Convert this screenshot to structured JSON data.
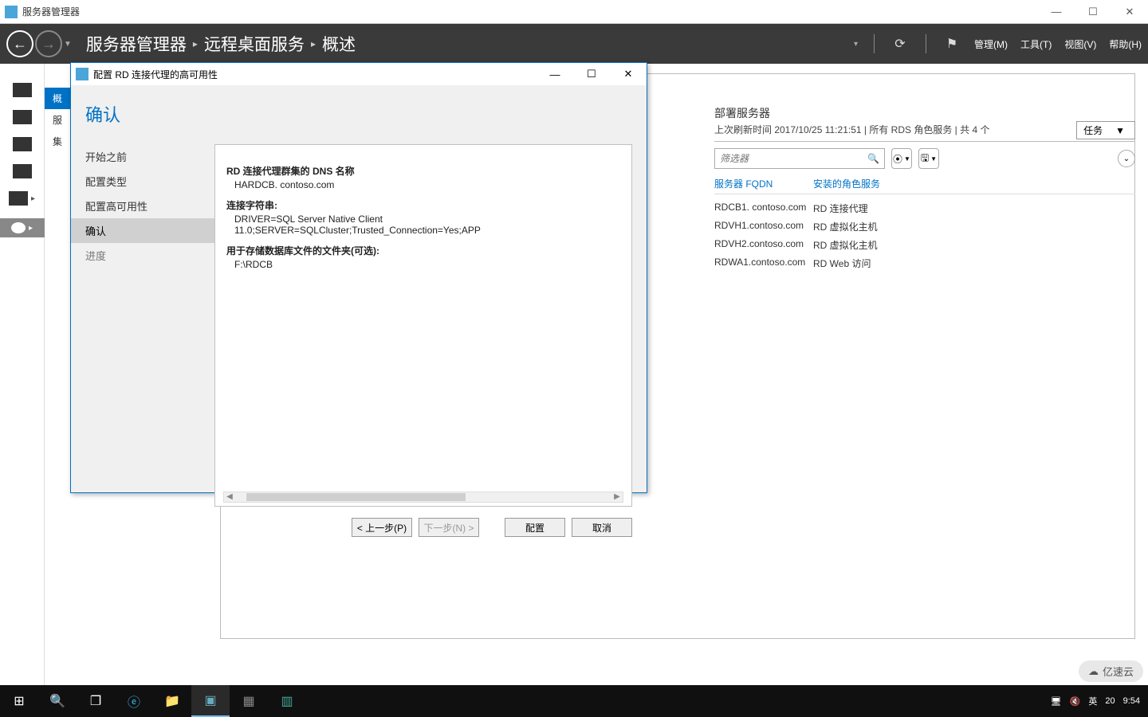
{
  "window": {
    "title": "服务器管理器",
    "minimize": "—",
    "maximize": "☐",
    "close": "✕"
  },
  "breadcrumb": {
    "part1": "服务器管理器",
    "part2": "远程桌面服务",
    "part3": "概述",
    "sep": "▸"
  },
  "menu": {
    "manage": "管理(M)",
    "tools": "工具(T)",
    "view": "视图(V)",
    "help": "帮助(H)"
  },
  "sidetabs": {
    "t1": "概",
    "t2": "服",
    "t3": "集"
  },
  "deploy": {
    "title": "部署服务器",
    "subtitle": "上次刷新时间 2017/10/25 11:21:51 | 所有 RDS 角色服务 | 共 4 个",
    "tasks": "任务",
    "filter_placeholder": "筛选器",
    "col_fqdn": "服务器 FQDN",
    "col_role": "安装的角色服务",
    "rows": [
      {
        "fqdn": "RDCB1. contoso.com",
        "role": "RD 连接代理"
      },
      {
        "fqdn": "RDVH1.contoso.com",
        "role": "RD 虚拟化主机"
      },
      {
        "fqdn": "RDVH2.contoso.com",
        "role": "RD 虚拟化主机"
      },
      {
        "fqdn": "RDWA1.contoso.com",
        "role": "RD Web 访问"
      }
    ]
  },
  "dialog": {
    "title": "配置 RD 连接代理的高可用性",
    "heading": "确认",
    "nav": {
      "step1": "开始之前",
      "step2": "配置类型",
      "step3": "配置高可用性",
      "step4": "确认",
      "step5": "进度"
    },
    "content": {
      "label_dns": "RD 连接代理群集的 DNS 名称",
      "val_dns": "HARDCB. contoso.com",
      "label_conn": "连接字符串:",
      "val_conn": "DRIVER=SQL Server Native Client 11.0;SERVER=SQLCluster;Trusted_Connection=Yes;APP",
      "label_folder": "用于存储数据库文件的文件夹(可选):",
      "val_folder": "F:\\RDCB"
    },
    "buttons": {
      "prev": "< 上一步(P)",
      "next": "下一步(N) >",
      "configure": "配置",
      "cancel": "取消"
    }
  },
  "taskbar": {
    "ime": "英",
    "num": "20",
    "time": "9:54"
  },
  "watermark": "亿速云"
}
